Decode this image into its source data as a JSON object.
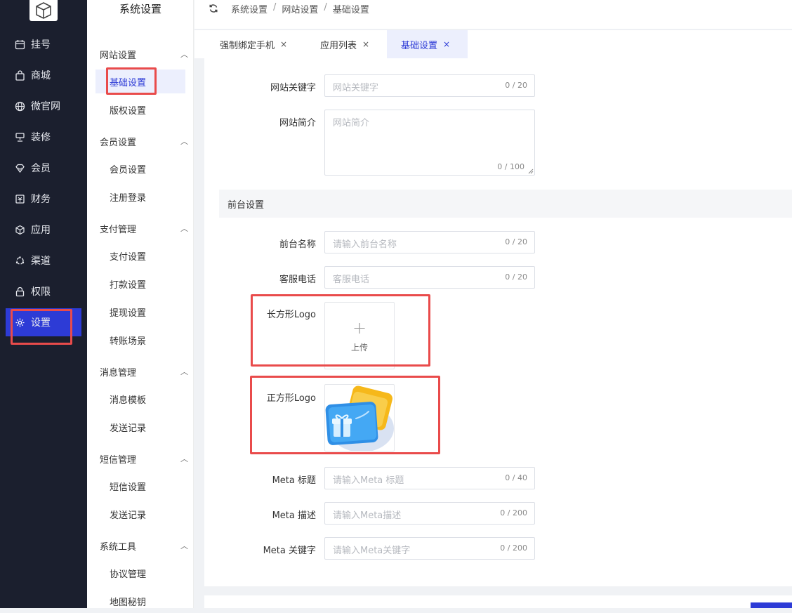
{
  "sidebar": {
    "items": [
      {
        "label": "挂号",
        "icon": "calendar-icon"
      },
      {
        "label": "商城",
        "icon": "shopping-bag-icon"
      },
      {
        "label": "微官网",
        "icon": "globe-icon"
      },
      {
        "label": "装修",
        "icon": "layout-icon"
      },
      {
        "label": "会员",
        "icon": "diamond-icon"
      },
      {
        "label": "财务",
        "icon": "finance-icon"
      },
      {
        "label": "应用",
        "icon": "cube-icon"
      },
      {
        "label": "渠道",
        "icon": "channel-icon"
      },
      {
        "label": "权限",
        "icon": "lock-icon"
      },
      {
        "label": "设置",
        "icon": "gear-icon",
        "active": true
      }
    ]
  },
  "submenu": {
    "title": "系统设置",
    "groups": [
      {
        "label": "网站设置",
        "items": [
          "基础设置",
          "版权设置"
        ]
      },
      {
        "label": "会员设置",
        "items": [
          "会员设置",
          "注册登录"
        ]
      },
      {
        "label": "支付管理",
        "items": [
          "支付设置",
          "打款设置",
          "提现设置",
          "转账场景"
        ]
      },
      {
        "label": "消息管理",
        "items": [
          "消息模板",
          "发送记录"
        ]
      },
      {
        "label": "短信管理",
        "items": [
          "短信设置",
          "发送记录"
        ]
      },
      {
        "label": "系统工具",
        "items": [
          "协议管理",
          "地图秘钥"
        ]
      }
    ]
  },
  "breadcrumb": [
    "系统设置",
    "网站设置",
    "基础设置"
  ],
  "breadcrumb_sep": "/",
  "tabs": [
    {
      "label": "强制绑定手机",
      "close": "×"
    },
    {
      "label": "应用列表",
      "close": "×"
    },
    {
      "label": "基础设置",
      "close": "×",
      "active": true
    }
  ],
  "form": {
    "keywords": {
      "label": "网站关键字",
      "placeholder": "网站关键字",
      "count": "0 / 20"
    },
    "intro": {
      "label": "网站简介",
      "placeholder": "网站简介",
      "count": "0 / 100"
    },
    "section": "前台设置",
    "front_name": {
      "label": "前台名称",
      "placeholder": "请输入前台名称",
      "count": "0 / 20"
    },
    "phone": {
      "label": "客服电话",
      "placeholder": "客服电话",
      "count": "0 / 20"
    },
    "rect_logo": {
      "label": "长方形Logo",
      "upload_text": "上传",
      "plus": "+"
    },
    "square_logo": {
      "label": "正方形Logo"
    },
    "meta_title": {
      "label": "Meta 标题",
      "placeholder": "请输入Meta 标题",
      "count": "0 / 40"
    },
    "meta_desc": {
      "label": "Meta 描述",
      "placeholder": "请输入Meta描述",
      "count": "0 / 200"
    },
    "meta_keywords": {
      "label": "Meta 关键字",
      "placeholder": "请输入Meta关键字",
      "count": "0 / 200"
    }
  },
  "colors": {
    "sidebar_bg": "#1b1f2e",
    "accent": "#2d3bd6",
    "highlight": "#e94b4b"
  }
}
